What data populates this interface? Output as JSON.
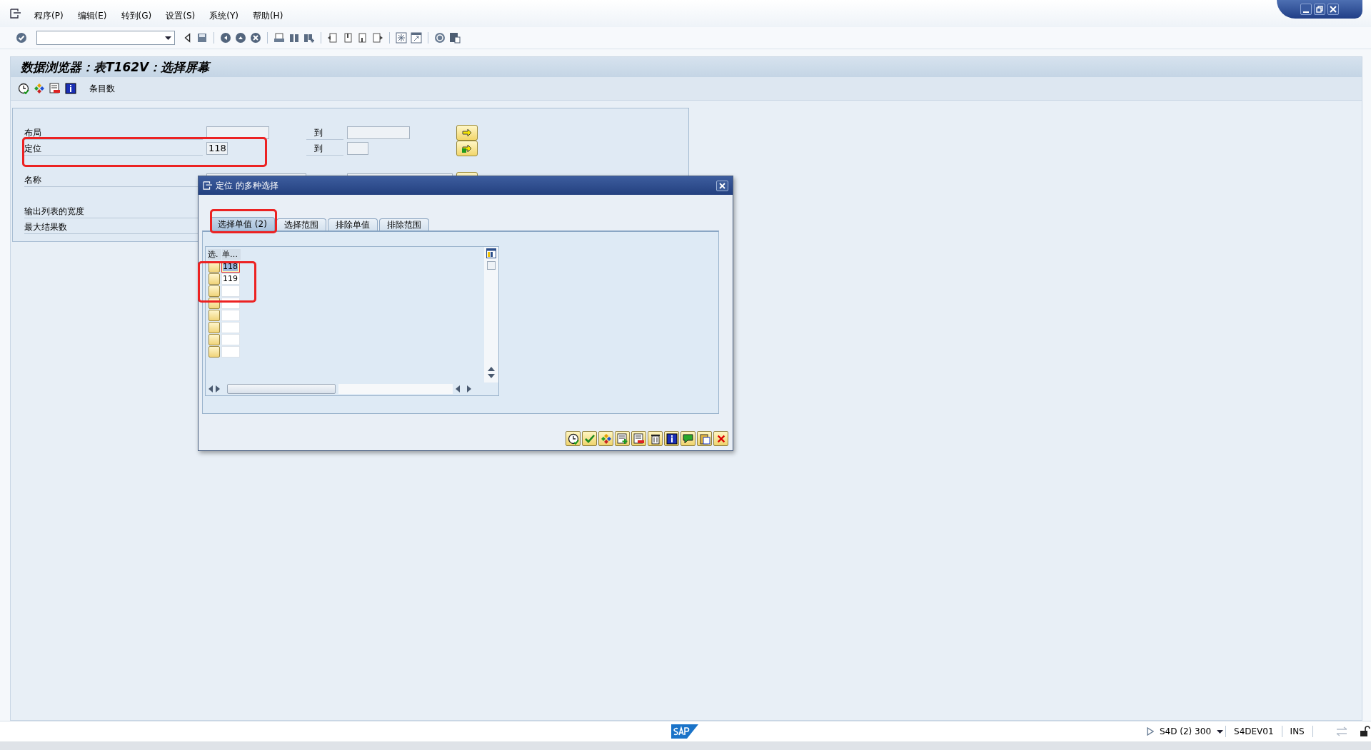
{
  "menu": [
    {
      "label": "程序(P)"
    },
    {
      "label": "编辑(E)"
    },
    {
      "label": "转到(G)"
    },
    {
      "label": "设置(S)"
    },
    {
      "label": "系统(Y)"
    },
    {
      "label": "帮助(H)"
    }
  ],
  "title": "数据浏览器：表T162V：选择屏幕",
  "app_toolbar": {
    "button_label": "条目数"
  },
  "form": {
    "rows": [
      {
        "label": "布局",
        "kind": "range",
        "from": "",
        "to_label": "到",
        "has_selection": false
      },
      {
        "label": "定位",
        "kind": "range",
        "from": "118",
        "to_label": "到",
        "has_selection": true
      },
      {
        "label": "名称",
        "kind": "range",
        "from": ""
      },
      {
        "label": "输出列表的宽度",
        "kind": "single"
      },
      {
        "label": "最大结果数",
        "kind": "single"
      }
    ]
  },
  "dialog": {
    "title": "定位 的多种选择",
    "tabs": [
      {
        "label": "选择单值 (2)",
        "selected": true
      },
      {
        "label": "选择范围",
        "selected": false
      },
      {
        "label": "排除单值",
        "selected": false
      },
      {
        "label": "排除范围",
        "selected": false
      }
    ],
    "table": {
      "columns": [
        "选.",
        "单…"
      ],
      "rows": [
        {
          "value": "118",
          "selected": true
        },
        {
          "value": "119",
          "selected": false
        }
      ]
    }
  },
  "status_bar": {
    "system": "S4D (2) 300",
    "server": "S4DEV01",
    "mode": "INS"
  },
  "annotations": [
    {
      "kind": "highlight"
    },
    {
      "kind": "highlight"
    },
    {
      "kind": "highlight"
    }
  ]
}
